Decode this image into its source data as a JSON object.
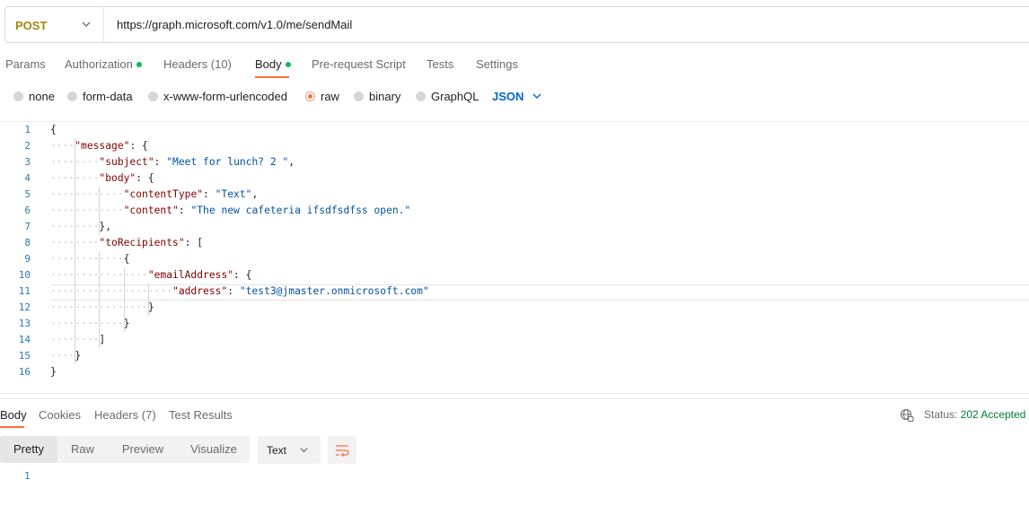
{
  "request": {
    "method": "POST",
    "url": "https://graph.microsoft.com/v1.0/me/sendMail"
  },
  "request_tabs": [
    {
      "label": "Params"
    },
    {
      "label": "Authorization",
      "indicator": true
    },
    {
      "label": "Headers",
      "count": "(10)"
    },
    {
      "label": "Body",
      "indicator": true,
      "active": true
    },
    {
      "label": "Pre-request Script"
    },
    {
      "label": "Tests"
    },
    {
      "label": "Settings"
    }
  ],
  "body_types": [
    {
      "label": "none"
    },
    {
      "label": "form-data"
    },
    {
      "label": "x-www-form-urlencoded"
    },
    {
      "label": "raw",
      "selected": true
    },
    {
      "label": "binary"
    },
    {
      "label": "GraphQL"
    }
  ],
  "format": "JSON",
  "editor": {
    "line_numbers": [
      "1",
      "2",
      "3",
      "4",
      "5",
      "6",
      "7",
      "8",
      "9",
      "10",
      "11",
      "12",
      "13",
      "14",
      "15",
      "16"
    ],
    "lines": [
      "{",
      "    \"message\": {",
      "        \"subject\": \"Meet for lunch? 2 \",",
      "        \"body\": {",
      "            \"contentType\": \"Text\",",
      "            \"content\": \"The new cafeteria ifsdfsdfss open.\"",
      "        },",
      "        \"toRecipients\": [",
      "            {",
      "                \"emailAddress\": {",
      "                    \"address\": \"test3@jmaster.onmicrosoft.com\"",
      "                }",
      "            }",
      "        ]",
      "    }",
      "}"
    ]
  },
  "response_tabs": [
    {
      "label": "Body",
      "active": true
    },
    {
      "label": "Cookies"
    },
    {
      "label": "Headers",
      "count": "(7)"
    },
    {
      "label": "Test Results"
    }
  ],
  "status": {
    "label": "Status:",
    "value": "202 Accepted"
  },
  "view_modes": [
    "Pretty",
    "Raw",
    "Preview",
    "Visualize"
  ],
  "response_format": "Text",
  "response_line_numbers": [
    "1"
  ],
  "icons": {
    "method_dropdown": "chevron-down-icon",
    "format_dropdown": "chevron-down-icon",
    "network": "globe-icon",
    "wrap": "wrap-lines-icon"
  },
  "colors": {
    "accent": "#ff6c37",
    "method": "#a5860a",
    "json_selector": "#0265d2",
    "key": "#800000",
    "string": "#0451a5",
    "status_ok": "#007f31",
    "indicator": "#0cbb52"
  }
}
